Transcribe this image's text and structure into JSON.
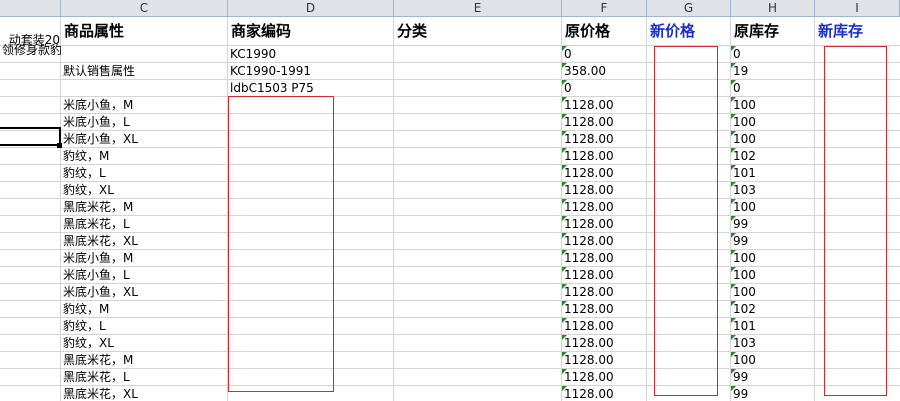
{
  "columns": [
    "C",
    "D",
    "E",
    "F",
    "G",
    "H",
    "I"
  ],
  "selected_col": "",
  "headers": {
    "C": "商品属性",
    "D": "商家编码",
    "E": "分类",
    "F": "原价格",
    "G": "新价格",
    "H": "原库存",
    "I": "新库存"
  },
  "colA_texts": [
    "动套装20",
    "领修身款豹"
  ],
  "rows": [
    {
      "C": "",
      "D": "KC1990",
      "F": "0",
      "H": "0"
    },
    {
      "C": "默认销售属性",
      "D": "KC1990-1991",
      "F": "358.00",
      "H": "19"
    },
    {
      "C": "",
      "D": "ldbC1503 P75",
      "F": "0",
      "H": "0"
    },
    {
      "C": "米底小鱼，M",
      "D": "",
      "F": "1128.00",
      "H": "100"
    },
    {
      "C": "米底小鱼，L",
      "D": "",
      "F": "1128.00",
      "H": "100"
    },
    {
      "C": "米底小鱼，XL",
      "D": "",
      "F": "1128.00",
      "H": "100"
    },
    {
      "C": "豹纹，M",
      "D": "",
      "F": "1128.00",
      "H": "102"
    },
    {
      "C": "豹纹，L",
      "D": "",
      "F": "1128.00",
      "H": "101"
    },
    {
      "C": "豹纹，XL",
      "D": "",
      "F": "1128.00",
      "H": "103"
    },
    {
      "C": "黑底米花，M",
      "D": "",
      "F": "1128.00",
      "H": "100"
    },
    {
      "C": "黑底米花，L",
      "D": "",
      "F": "1128.00",
      "H": "99"
    },
    {
      "C": "黑底米花，XL",
      "D": "",
      "F": "1128.00",
      "H": "99"
    },
    {
      "C": "米底小鱼，M",
      "D": "",
      "F": "1128.00",
      "H": "100"
    },
    {
      "C": "米底小鱼，L",
      "D": "",
      "F": "1128.00",
      "H": "100"
    },
    {
      "C": "米底小鱼，XL",
      "D": "",
      "F": "1128.00",
      "H": "100"
    },
    {
      "C": "豹纹，M",
      "D": "",
      "F": "1128.00",
      "H": "102"
    },
    {
      "C": "豹纹，L",
      "D": "",
      "F": "1128.00",
      "H": "101"
    },
    {
      "C": "豹纹，XL",
      "D": "",
      "F": "1128.00",
      "H": "103"
    },
    {
      "C": "黑底米花，M",
      "D": "",
      "F": "1128.00",
      "H": "100"
    },
    {
      "C": "黑底米花，L",
      "D": "",
      "F": "1128.00",
      "H": "99"
    },
    {
      "C": "黑底米花，XL",
      "D": "",
      "F": "1128.00",
      "H": "99"
    }
  ],
  "colors": {
    "highlight_box": "#d8262b",
    "blue_header": "#1a2fd0",
    "number_indicator": "#2a8a2a"
  }
}
